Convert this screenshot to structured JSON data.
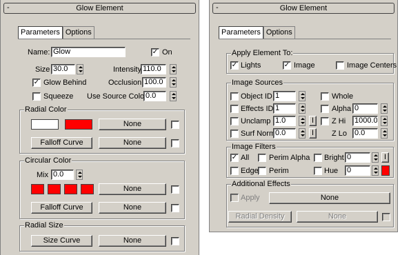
{
  "left": {
    "title": "Glow Element",
    "tabs": [
      "Parameters",
      "Options"
    ],
    "name_label": "Name:",
    "name_value": "Glow",
    "on_label": "On",
    "on_checked": true,
    "size_label": "Size",
    "size_value": "30.0",
    "intensity_label": "Intensity",
    "intensity_value": "110.0",
    "glow_behind_label": "Glow Behind",
    "glow_behind_checked": true,
    "occlusion_label": "Occlusion",
    "occlusion_value": "100.0",
    "squeeze_label": "Squeeze",
    "use_source_color_label": "Use Source Color",
    "use_source_color_value": "0.0",
    "radial_color": {
      "title": "Radial Color",
      "swatch1": "#ffffff",
      "swatch2": "#ff0000",
      "map_label": "None",
      "falloff_label": "Falloff Curve",
      "falloff_map": "None"
    },
    "circular_color": {
      "title": "Circular Color",
      "mix_label": "Mix",
      "mix_value": "0.0",
      "swatch_color": "#ff0000",
      "map_label": "None",
      "falloff_label": "Falloff Curve",
      "falloff_map": "None"
    },
    "radial_size": {
      "title": "Radial Size",
      "curve_label": "Size Curve",
      "map_label": "None"
    }
  },
  "right": {
    "title": "Glow Element",
    "tabs": [
      "Parameters",
      "Options"
    ],
    "apply": {
      "title": "Apply Element To:",
      "lights": "Lights",
      "image": "Image",
      "image_centers": "Image Centers"
    },
    "sources": {
      "title": "Image Sources",
      "object_id": "Object ID",
      "object_id_value": "1",
      "effects_id": "Effects ID",
      "effects_id_value": "1",
      "unclamp": "Unclamp",
      "unclamp_value": "1.0",
      "surf_norm": "Surf Norm",
      "surf_norm_value": "0.0",
      "whole": "Whole",
      "alpha": "Alpha",
      "alpha_value": "0",
      "zhi": "Z Hi",
      "zhi_value": "1000.0",
      "zlo": "Z Lo",
      "zlo_value": "0.0",
      "i_label": "I"
    },
    "filters": {
      "title": "Image Filters",
      "all": "All",
      "perim_alpha": "Perim Alpha",
      "bright": "Bright",
      "bright_value": "0",
      "edge": "Edge",
      "perim": "Perim",
      "hue": "Hue",
      "hue_value": "0",
      "hue_color": "#ff0000",
      "i_label": "I"
    },
    "additional": {
      "title": "Additional Effects",
      "apply": "Apply",
      "apply_map": "None",
      "radial_density": "Radial Density",
      "density_map": "None"
    }
  }
}
